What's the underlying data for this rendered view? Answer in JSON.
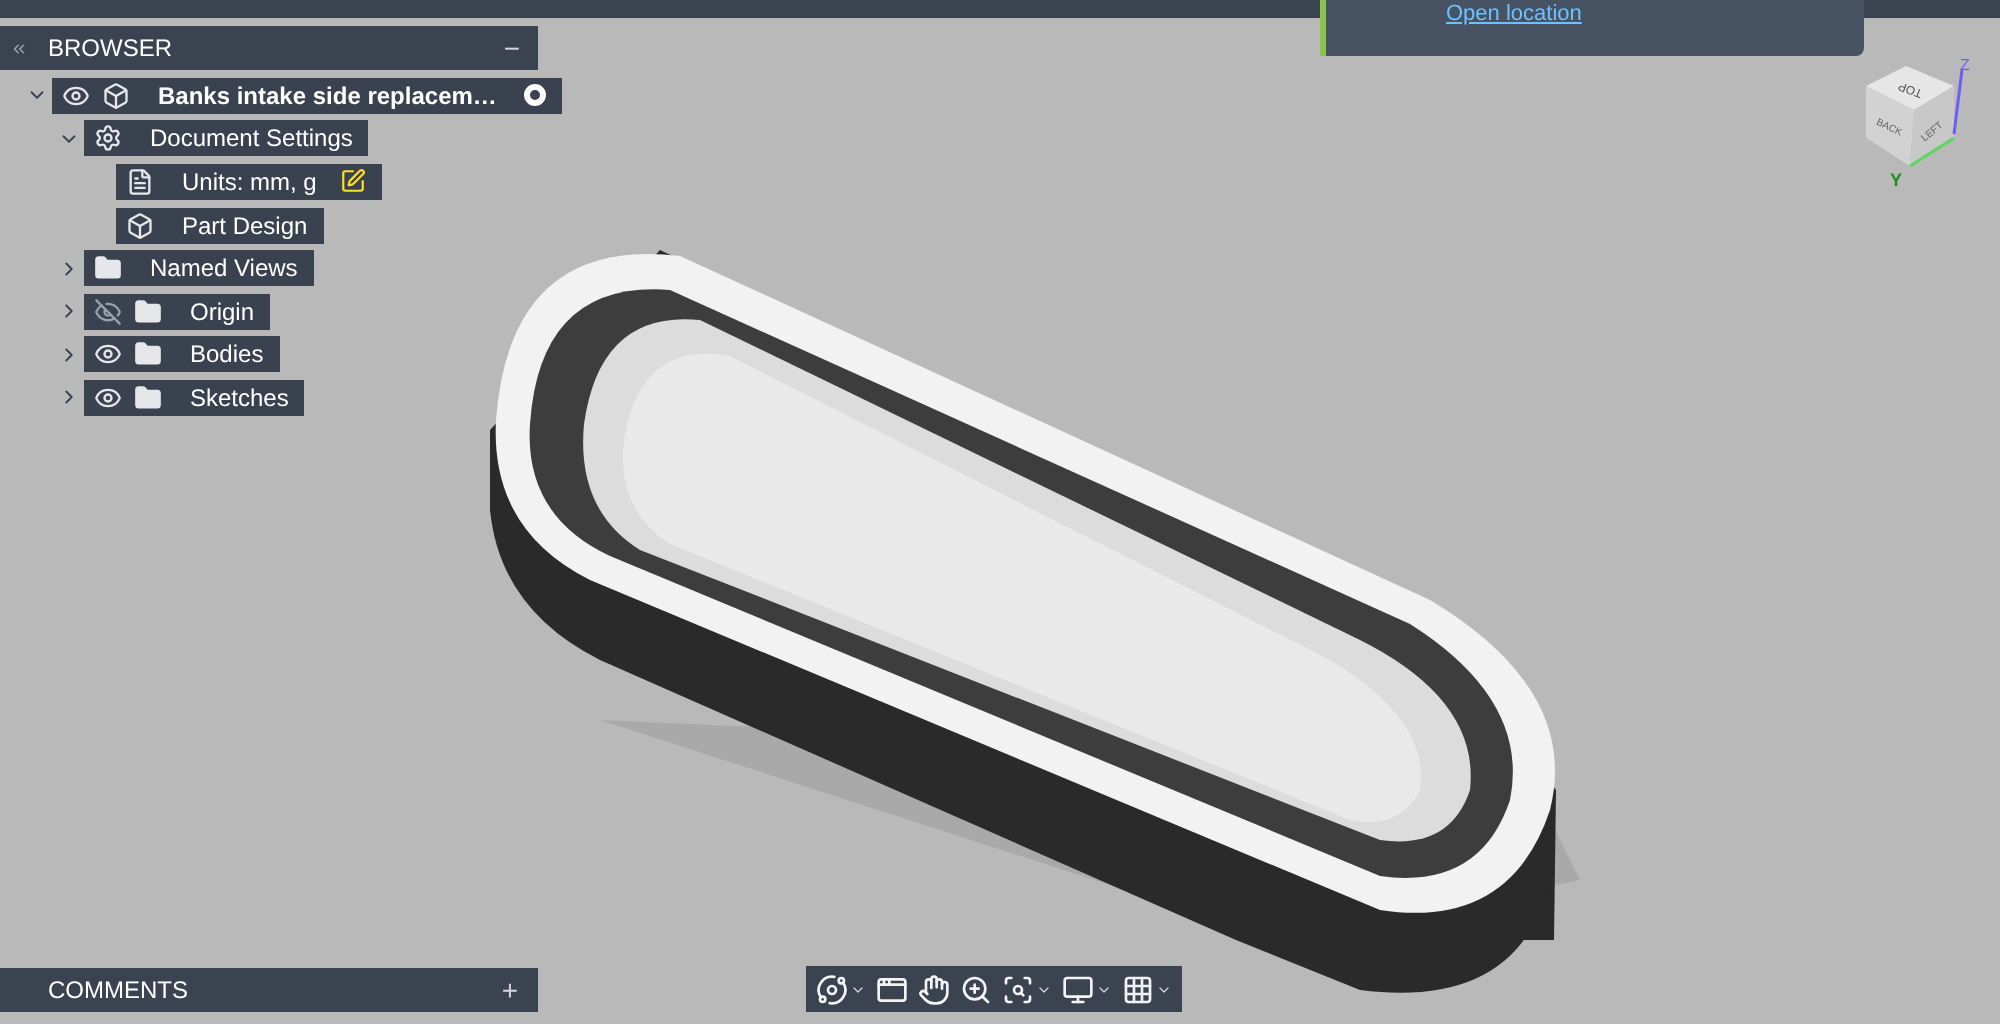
{
  "browser": {
    "title": "BROWSER",
    "collapse": "−",
    "tree": [
      {
        "label": "Banks intake side replacem…",
        "kind": "component",
        "visible": true,
        "expanded": true,
        "active": true,
        "children": [
          {
            "label": "Document Settings",
            "kind": "settings",
            "expanded": true,
            "children": [
              {
                "label": "Units: mm, g",
                "kind": "units"
              },
              {
                "label": "Part Design",
                "kind": "part"
              }
            ]
          },
          {
            "label": "Named Views",
            "kind": "folder",
            "expanded": false
          },
          {
            "label": "Origin",
            "kind": "folder",
            "visible": false,
            "expanded": false
          },
          {
            "label": "Bodies",
            "kind": "folder",
            "visible": true,
            "expanded": false
          },
          {
            "label": "Sketches",
            "kind": "folder",
            "visible": true,
            "expanded": false
          }
        ]
      }
    ]
  },
  "notification": {
    "link": "Open location"
  },
  "view_cube": {
    "faces": [
      "TOP",
      "BACK",
      "LEFT"
    ],
    "axes": [
      "Z",
      "Y"
    ]
  },
  "comments": {
    "title": "COMMENTS",
    "add": "+"
  },
  "nav_toolbar": [
    {
      "kind": "orbit",
      "dropdown": true
    },
    {
      "kind": "look",
      "dropdown": false
    },
    {
      "kind": "pan",
      "dropdown": false
    },
    {
      "kind": "zoom",
      "dropdown": false
    },
    {
      "kind": "fit",
      "dropdown": true
    },
    {
      "kind": "display",
      "dropdown": true
    },
    {
      "kind": "grid",
      "dropdown": true
    }
  ]
}
